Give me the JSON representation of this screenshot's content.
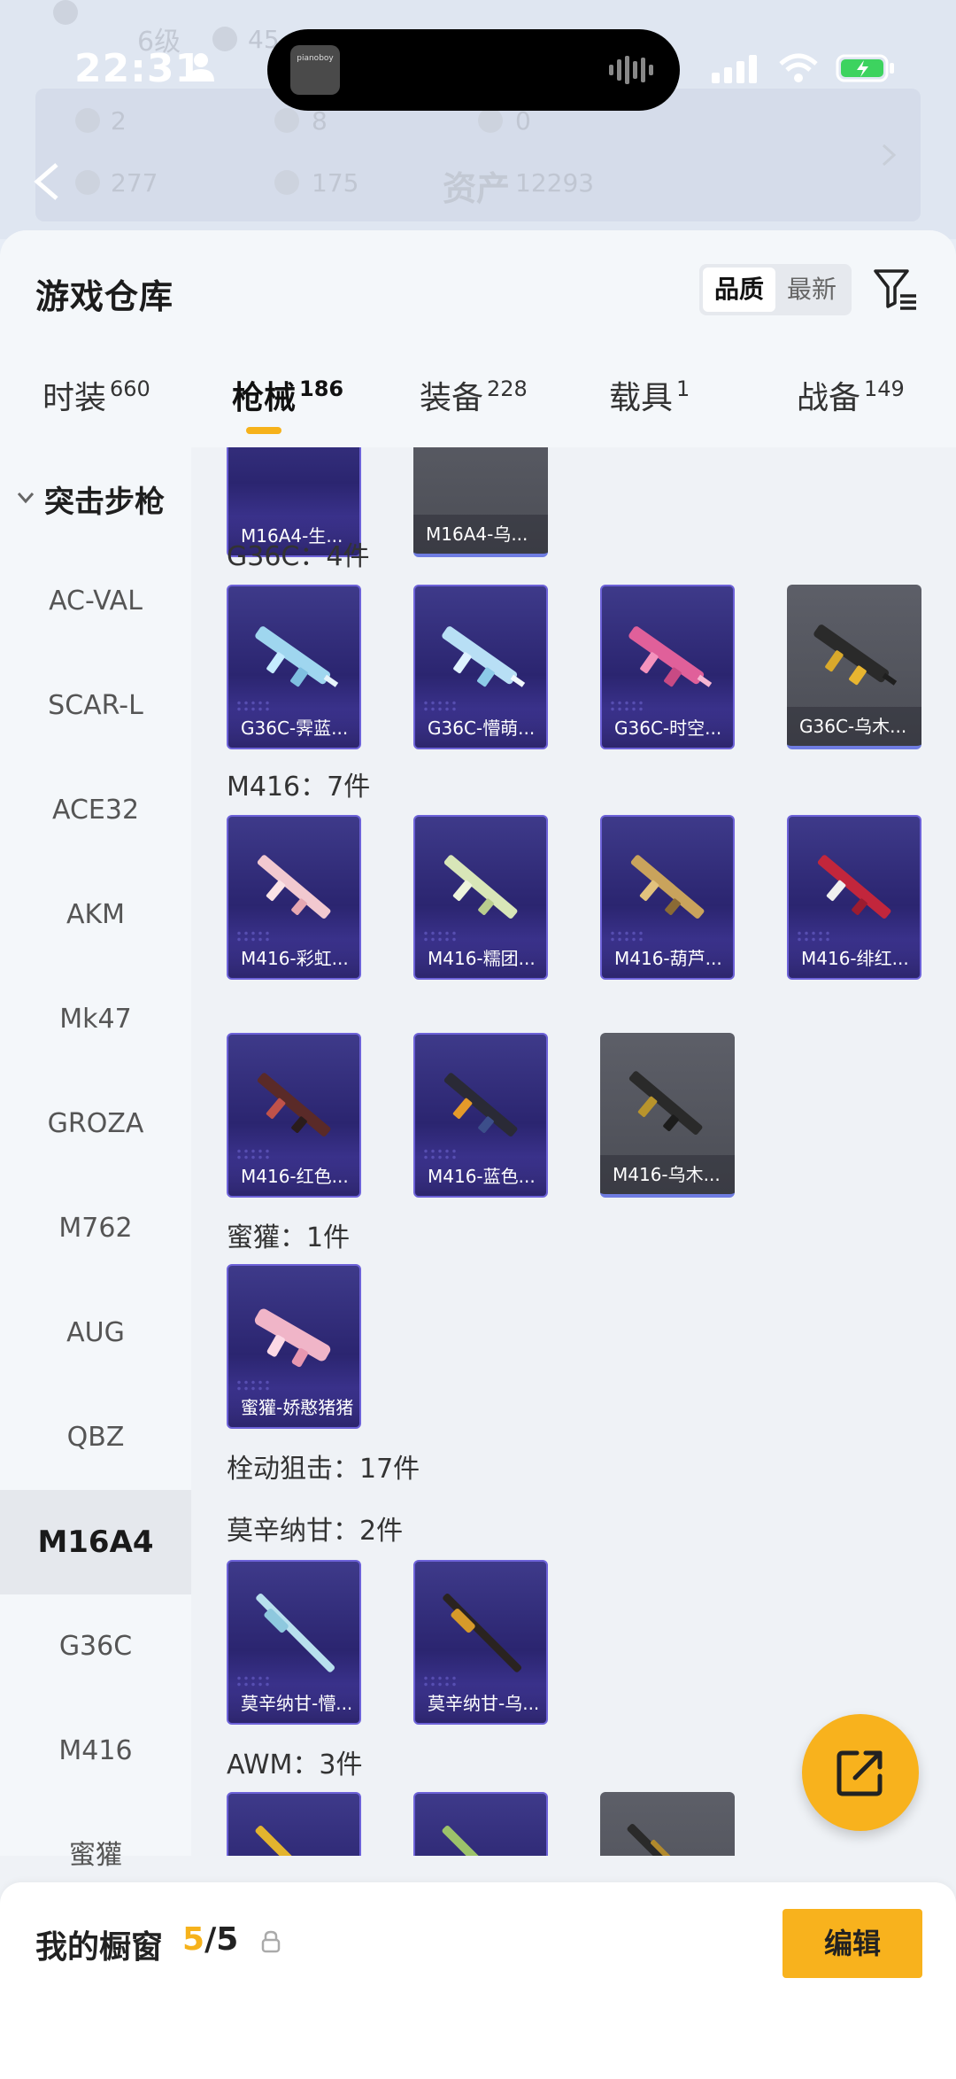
{
  "status_bar": {
    "time": "22:31"
  },
  "island": {
    "album_text": "pianoboy"
  },
  "background": {
    "rank_label": "6级",
    "partial_number": "45",
    "stats_row1": [
      "2",
      "8",
      "0"
    ],
    "stats_row2": [
      "277",
      "175"
    ],
    "assets_label": "资产",
    "assets_value": "12293"
  },
  "sheet": {
    "title": "游戏仓库",
    "sort_options": [
      "品质",
      "最新"
    ],
    "tabs": [
      {
        "label": "时装",
        "count": "660"
      },
      {
        "label": "枪械",
        "count": "186"
      },
      {
        "label": "装备",
        "count": "228"
      },
      {
        "label": "载具",
        "count": "1"
      },
      {
        "label": "战备",
        "count": "149"
      }
    ]
  },
  "sidebar": {
    "group_label": "突击步枪",
    "items": [
      "AC-VAL",
      "SCAR-L",
      "ACE32",
      "AKM",
      "Mk47",
      "GROZA",
      "M762",
      "AUG",
      "QBZ",
      "M16A4",
      "G36C",
      "M416",
      "蜜獾"
    ],
    "active_item": "M16A4"
  },
  "grid": {
    "top_partial_cards": [
      "M16A4-生...",
      "M16A4-乌..."
    ],
    "sections": [
      {
        "label": "G36C：4件",
        "cards": [
          "G36C-霁蓝...",
          "G36C-懵萌...",
          "G36C-时空...",
          "G36C-乌木..."
        ]
      },
      {
        "label": "M416：7件",
        "cards": [
          "M416-彩虹...",
          "M416-糯团...",
          "M416-葫芦...",
          "M416-绯红...",
          "M416-红色...",
          "M416-蓝色...",
          "M416-乌木..."
        ]
      },
      {
        "label": "蜜獾：1件",
        "cards": [
          "蜜獾-娇憨猪猪"
        ]
      },
      {
        "label": "栓动狙击：17件",
        "cards": []
      },
      {
        "label": "莫辛纳甘：2件",
        "cards": [
          "莫辛纳甘-懵...",
          "莫辛纳甘-乌..."
        ]
      },
      {
        "label": "AWM：3件",
        "cards": []
      }
    ]
  },
  "bottom_bar": {
    "label": "我的橱窗",
    "count_current": "5",
    "count_total": "/5",
    "edit_label": "编辑"
  },
  "colors": {
    "accent": "#f8b21d",
    "card_purple": "#2b2570",
    "card_gray": "#55575f",
    "card_border": "#6d62d8"
  }
}
